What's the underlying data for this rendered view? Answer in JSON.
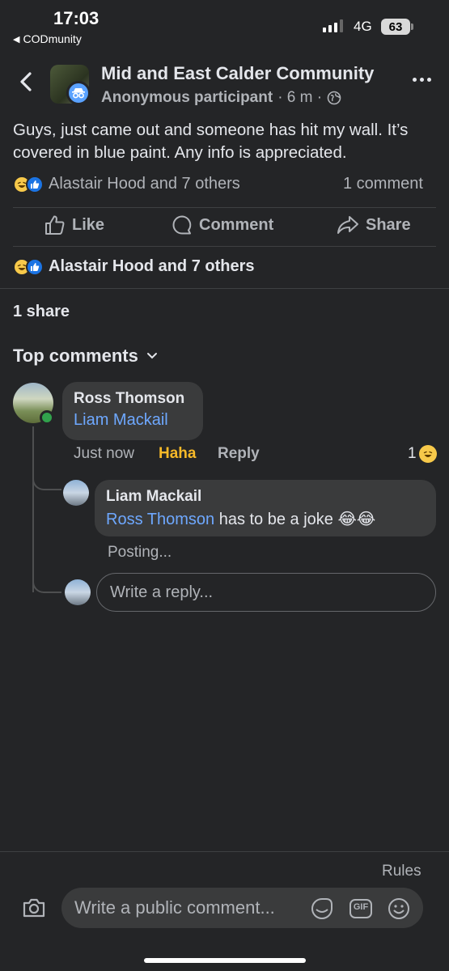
{
  "status_bar": {
    "time": "17:03",
    "back_app": "CODmunity",
    "network": "4G",
    "battery": "63"
  },
  "header": {
    "group_name": "Mid and East Calder Community",
    "author": "Anonymous participant",
    "time_ago": "· 6 m ·"
  },
  "post": {
    "text": "Guys, just came out and someone has hit my wall. It’s covered in blue paint. Any info is appreciated.",
    "reactions_summary": "Alastair Hood and 7 others",
    "comment_count": "1 comment"
  },
  "actions": {
    "like": "Like",
    "comment": "Comment",
    "share": "Share"
  },
  "reactions_detail": "Alastair Hood and 7 others",
  "share_count": "1 share",
  "top_comments_label": "Top comments",
  "comments": [
    {
      "author": "Ross Thomson",
      "mention": "Liam Mackail",
      "time": "Just now",
      "reaction_label": "Haha",
      "reply_label": "Reply",
      "reaction_count": "1"
    }
  ],
  "reply": {
    "author": "Liam Mackail",
    "mention": "Ross Thomson",
    "text": " has to be a joke 😂😂",
    "status": "Posting..."
  },
  "reply_input": {
    "placeholder": "Write a reply..."
  },
  "bottom": {
    "rules": "Rules",
    "comment_placeholder": "Write a public comment...",
    "gif_label": "GIF"
  },
  "colors": {
    "background": "#242527",
    "bubble": "#3a3b3c",
    "mention": "#6ea8ff",
    "haha": "#f7b928",
    "like_blue": "#1b74e4",
    "online": "#31a24c"
  }
}
